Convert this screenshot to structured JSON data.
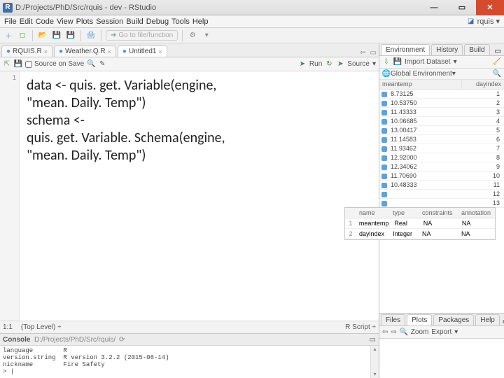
{
  "window": {
    "title": "D:/Projects/PhD/Src/rquis - dev - RStudio",
    "buttons": {
      "min": "—",
      "max": "▭",
      "close": "✕"
    }
  },
  "menu": [
    "File",
    "Edit",
    "Code",
    "View",
    "Plots",
    "Session",
    "Build",
    "Debug",
    "Tools",
    "Help"
  ],
  "package_label": "rquis",
  "gotobox_placeholder": "Go to file/function",
  "editor_tabs": [
    {
      "label": "RQUIS.R",
      "icon": "●"
    },
    {
      "label": "Weather.Q.R",
      "icon": "●"
    },
    {
      "label": "Untitled1",
      "icon": "●"
    }
  ],
  "srcbar": {
    "source_on_save": "Source on Save",
    "run": "Run",
    "rerun": "",
    "source_btn": "Source"
  },
  "gutter_line": "1",
  "code_overlay": [
    "data <- quis. get. Variable(engine,",
    "\"mean. Daily. Temp\")",
    "",
    "schema <-",
    "quis. get. Variable. Schema(engine,",
    "\"mean. Daily. Temp\")"
  ],
  "statusbar": {
    "pos": "1:1",
    "scope": "(Top Level) ÷",
    "lang": "R Script ÷"
  },
  "console": {
    "header": "Console  D:/Projects/PhD/Src/rquis/",
    "lines": [
      "language        R",
      "version.string  R version 3.2.2 (2015-08-14)",
      "nickname        Fire Safety",
      "> |"
    ]
  },
  "right": {
    "tabs_top": [
      "Environment",
      "History",
      "Build"
    ],
    "toolbar_import": "Import Dataset",
    "scope": "Global Environment",
    "cols": {
      "c1": "meantemp",
      "c2": "dayindex"
    },
    "rows": [
      {
        "v": "8.73125",
        "i": "1"
      },
      {
        "v": "10.53750",
        "i": "2"
      },
      {
        "v": "11.43333",
        "i": "3"
      },
      {
        "v": "10.06685",
        "i": "4"
      },
      {
        "v": "13.00417",
        "i": "5"
      },
      {
        "v": "11.14583",
        "i": "6"
      },
      {
        "v": "11.93462",
        "i": "7"
      },
      {
        "v": "12.92000",
        "i": "8"
      },
      {
        "v": "12.34062",
        "i": "9"
      },
      {
        "v": "11.70690",
        "i": "10"
      },
      {
        "v": "10.48333",
        "i": "11"
      }
    ],
    "more_rows": [
      "12",
      "13"
    ],
    "tabs_bottom": [
      "Files",
      "Plots",
      "Packages",
      "Help"
    ],
    "plot_toolbar": {
      "zoom": "Zoom",
      "export": "Export"
    }
  },
  "schema": {
    "head": [
      "",
      "name",
      "type",
      "constraints",
      "annotation"
    ],
    "rows": [
      {
        "n": "1",
        "a": "meantemp",
        "b": "Real",
        "c": "NA",
        "d": "NA"
      },
      {
        "n": "2",
        "a": "dayindex",
        "b": "Integer",
        "c": "NA",
        "d": "NA"
      }
    ]
  }
}
